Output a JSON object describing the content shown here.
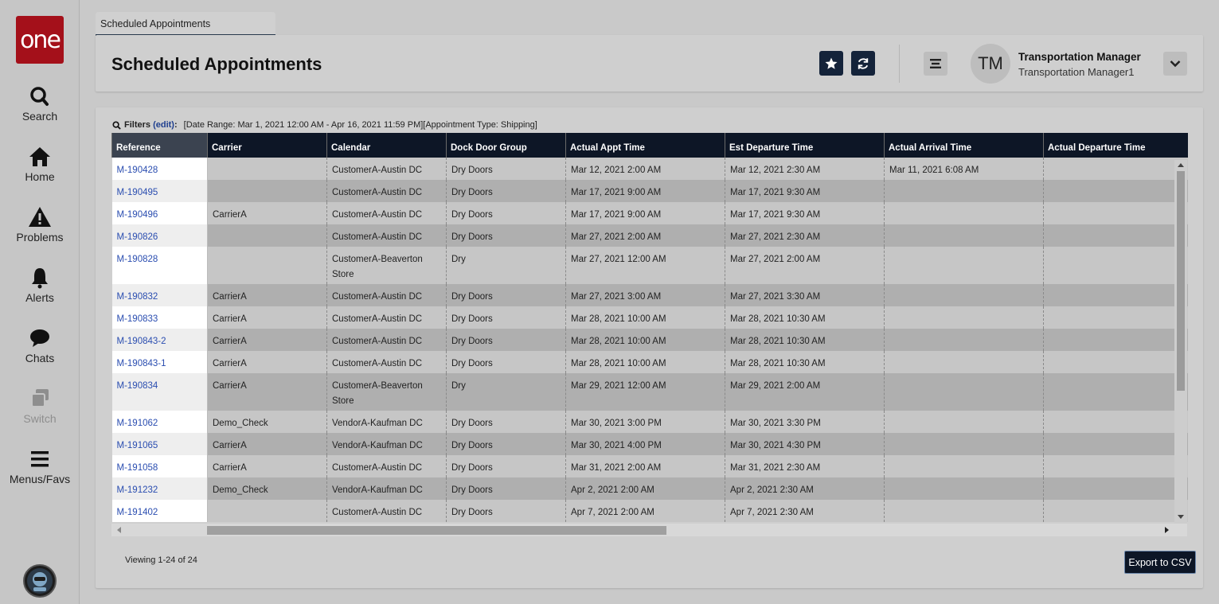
{
  "brand": {
    "logo_text": "one",
    "color": "#a4101a"
  },
  "nav": [
    {
      "label": "Search",
      "icon": "search-icon"
    },
    {
      "label": "Home",
      "icon": "home-icon"
    },
    {
      "label": "Problems",
      "icon": "warning-icon"
    },
    {
      "label": "Alerts",
      "icon": "bell-icon"
    },
    {
      "label": "Chats",
      "icon": "chat-bubble-icon"
    },
    {
      "label": "Switch",
      "icon": "switch-windows-icon",
      "disabled": true
    },
    {
      "label": "Menus/Favs",
      "icon": "hamburger-menu-icon"
    }
  ],
  "tab": {
    "label": "Scheduled Appointments"
  },
  "header": {
    "title": "Scheduled Appointments",
    "user_initials": "TM",
    "user_name": "Transportation Manager",
    "user_role": "Transportation Manager1"
  },
  "filters": {
    "label": "Filters",
    "edit_label": "(edit)",
    "colon": ":",
    "text": "[Date Range: Mar 1, 2021 12:00 AM - Apr 16, 2021 11:59 PM][Appointment Type: Shipping]"
  },
  "table": {
    "columns": [
      "Reference",
      "Carrier",
      "Calendar",
      "Dock Door Group",
      "Actual Appt Time",
      "Est Departure Time",
      "Actual Arrival Time",
      "Actual Departure Time"
    ],
    "rows": [
      [
        "M-190428",
        "",
        "CustomerA-Austin DC",
        "Dry Doors",
        "Mar 12, 2021 2:00 AM",
        "Mar 12, 2021 2:30 AM",
        "Mar 11, 2021 6:08 AM",
        ""
      ],
      [
        "M-190495",
        "",
        "CustomerA-Austin DC",
        "Dry Doors",
        "Mar 17, 2021 9:00 AM",
        "Mar 17, 2021 9:30 AM",
        "",
        ""
      ],
      [
        "M-190496",
        "CarrierA",
        "CustomerA-Austin DC",
        "Dry Doors",
        "Mar 17, 2021 9:00 AM",
        "Mar 17, 2021 9:30 AM",
        "",
        ""
      ],
      [
        "M-190826",
        "",
        "CustomerA-Austin DC",
        "Dry Doors",
        "Mar 27, 2021 2:00 AM",
        "Mar 27, 2021 2:30 AM",
        "",
        ""
      ],
      [
        "M-190828",
        "",
        "CustomerA-Beaverton Store",
        "Dry",
        "Mar 27, 2021 12:00 AM",
        "Mar 27, 2021 2:00 AM",
        "",
        ""
      ],
      [
        "M-190832",
        "CarrierA",
        "CustomerA-Austin DC",
        "Dry Doors",
        "Mar 27, 2021 3:00 AM",
        "Mar 27, 2021 3:30 AM",
        "",
        ""
      ],
      [
        "M-190833",
        "CarrierA",
        "CustomerA-Austin DC",
        "Dry Doors",
        "Mar 28, 2021 10:00 AM",
        "Mar 28, 2021 10:30 AM",
        "",
        ""
      ],
      [
        "M-190843-2",
        "CarrierA",
        "CustomerA-Austin DC",
        "Dry Doors",
        "Mar 28, 2021 10:00 AM",
        "Mar 28, 2021 10:30 AM",
        "",
        ""
      ],
      [
        "M-190843-1",
        "CarrierA",
        "CustomerA-Austin DC",
        "Dry Doors",
        "Mar 28, 2021 10:00 AM",
        "Mar 28, 2021 10:30 AM",
        "",
        ""
      ],
      [
        "M-190834",
        "CarrierA",
        "CustomerA-Beaverton Store",
        "Dry",
        "Mar 29, 2021 12:00 AM",
        "Mar 29, 2021 2:00 AM",
        "",
        ""
      ],
      [
        "M-191062",
        "Demo_Check",
        "VendorA-Kaufman DC",
        "Dry Doors",
        "Mar 30, 2021 3:00 PM",
        "Mar 30, 2021 3:30 PM",
        "",
        ""
      ],
      [
        "M-191065",
        "CarrierA",
        "VendorA-Kaufman DC",
        "Dry Doors",
        "Mar 30, 2021 4:00 PM",
        "Mar 30, 2021 4:30 PM",
        "",
        ""
      ],
      [
        "M-191058",
        "CarrierA",
        "CustomerA-Austin DC",
        "Dry Doors",
        "Mar 31, 2021 2:00 AM",
        "Mar 31, 2021 2:30 AM",
        "",
        ""
      ],
      [
        "M-191232",
        "Demo_Check",
        "VendorA-Kaufman DC",
        "Dry Doors",
        "Apr 2, 2021 2:00 AM",
        "Apr 2, 2021 2:30 AM",
        "",
        ""
      ],
      [
        "M-191402",
        "",
        "CustomerA-Austin DC",
        "Dry Doors",
        "Apr 7, 2021 2:00 AM",
        "Apr 7, 2021 2:30 AM",
        "",
        ""
      ]
    ]
  },
  "footer": {
    "viewing": "Viewing 1-24 of 24",
    "export_label": "Export to CSV"
  }
}
